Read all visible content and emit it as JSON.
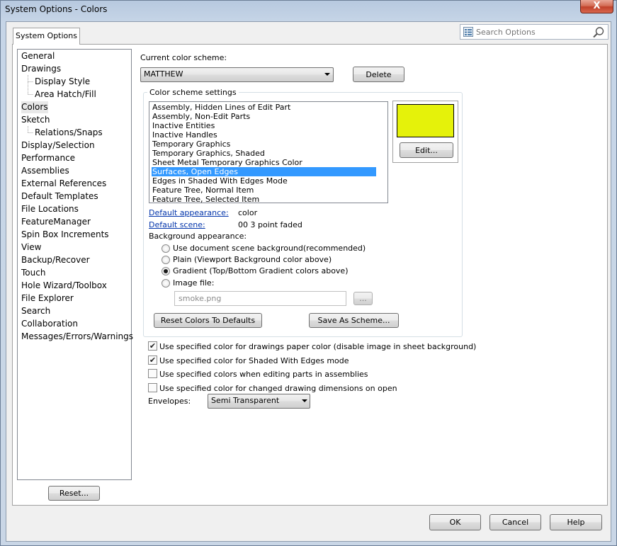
{
  "window": {
    "title": "System Options - Colors",
    "close_glyph": "X"
  },
  "tab": {
    "label": "System Options"
  },
  "search": {
    "placeholder": "Search Options",
    "icon": "search-icon"
  },
  "nav": {
    "items": [
      {
        "label": "General"
      },
      {
        "label": "Drawings"
      },
      {
        "label": "Display Style"
      },
      {
        "label": "Area Hatch/Fill"
      },
      {
        "label": "Colors",
        "selected": true
      },
      {
        "label": "Sketch"
      },
      {
        "label": "Relations/Snaps"
      },
      {
        "label": "Display/Selection"
      },
      {
        "label": "Performance"
      },
      {
        "label": "Assemblies"
      },
      {
        "label": "External References"
      },
      {
        "label": "Default Templates"
      },
      {
        "label": "File Locations"
      },
      {
        "label": "FeatureManager"
      },
      {
        "label": "Spin Box Increments"
      },
      {
        "label": "View"
      },
      {
        "label": "Backup/Recover"
      },
      {
        "label": "Touch"
      },
      {
        "label": "Hole Wizard/Toolbox"
      },
      {
        "label": "File Explorer"
      },
      {
        "label": "Search"
      },
      {
        "label": "Collaboration"
      },
      {
        "label": "Messages/Errors/Warnings"
      }
    ],
    "reset_label": "Reset..."
  },
  "scheme": {
    "label": "Current color scheme:",
    "value": "MATTHEW",
    "delete_label": "Delete"
  },
  "settings": {
    "title": "Color scheme settings",
    "items": [
      "Assembly, Hidden Lines of Edit Part",
      "Assembly, Non-Edit Parts",
      "Inactive Entities",
      "Inactive Handles",
      "Temporary Graphics",
      "Temporary Graphics, Shaded",
      "Sheet Metal Temporary Graphics Color",
      "Surfaces, Open Edges",
      "Edges in Shaded With Edges Mode",
      "Feature Tree, Normal Item",
      "Feature Tree, Selected Item"
    ],
    "selected_index": 7,
    "swatch_color": "#e5f20a",
    "edit_label": "Edit..."
  },
  "appearance": {
    "default_appearance_label": "Default appearance:",
    "default_appearance_value": "color",
    "default_scene_label": "Default scene:",
    "default_scene_value": "00 3 point faded",
    "background_label": "Background appearance:",
    "options": [
      {
        "label": "Use document scene background(recommended)",
        "checked": false
      },
      {
        "label": "Plain (Viewport Background color above)",
        "checked": false
      },
      {
        "label": "Gradient (Top/Bottom Gradient colors above)",
        "checked": true
      },
      {
        "label": "Image file:",
        "checked": false
      }
    ],
    "image_file": "smoke.png",
    "browse_label": "...",
    "reset_colors_label": "Reset Colors To Defaults",
    "save_scheme_label": "Save As Scheme..."
  },
  "checks": [
    {
      "label": "Use specified color for drawings paper color (disable image in sheet background)",
      "checked": true
    },
    {
      "label": "Use specified color for Shaded With Edges mode",
      "checked": true
    },
    {
      "label": "Use specified colors when editing parts in assemblies",
      "checked": false
    },
    {
      "label": "Use specified color for changed drawing dimensions on open",
      "checked": false
    }
  ],
  "envelopes": {
    "label": "Envelopes:",
    "value": "Semi Transparent"
  },
  "footer": {
    "ok": "OK",
    "cancel": "Cancel",
    "help": "Help"
  }
}
